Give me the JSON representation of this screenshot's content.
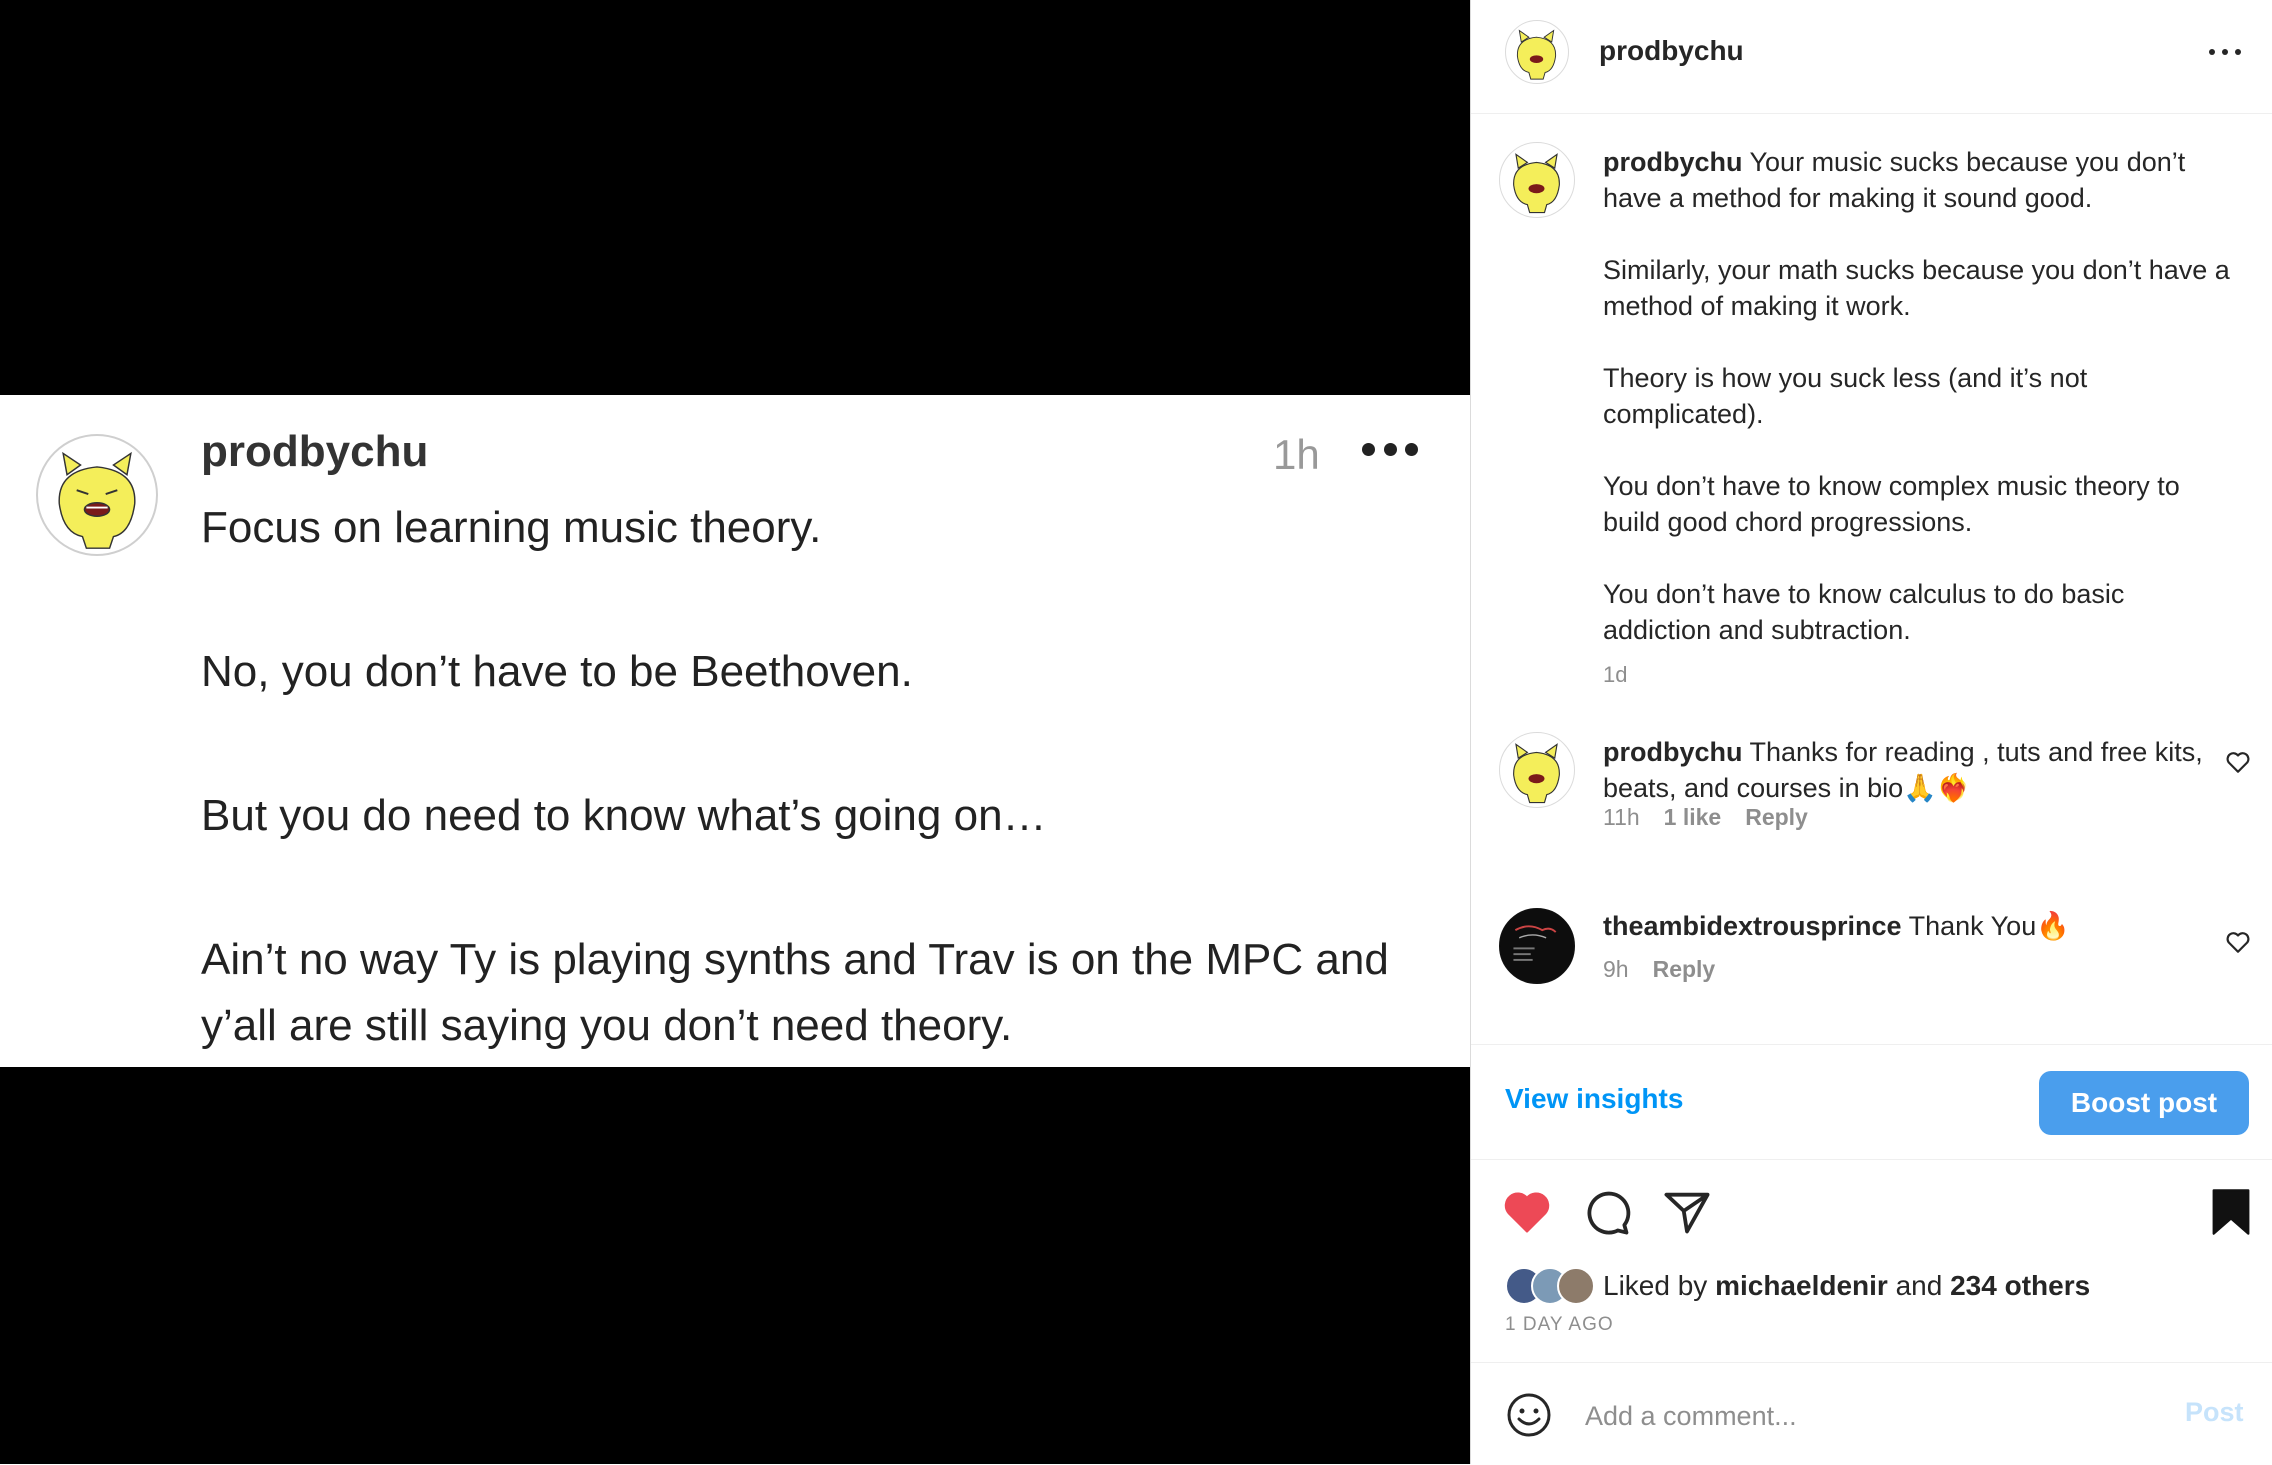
{
  "media": {
    "card": {
      "username": "prodbychu",
      "time": "1h",
      "paragraphs": [
        "Focus on learning music theory.",
        "No, you don’t have to be Beethoven.",
        "But you do need to know what’s going on…",
        "Ain’t no way Ty is playing synths and Trav is on the MPC and y’all are still saying you don’t need theory."
      ]
    }
  },
  "header": {
    "username": "prodbychu"
  },
  "caption": {
    "username": "prodbychu",
    "paragraphs": [
      "Your music sucks because you don’t have a method for making it sound good.",
      "Similarly, your math sucks because you don’t have a method of making it work.",
      "Theory is how you suck less (and it’s not complicated).",
      "You don’t have to know complex music theory to build good chord progressions.",
      "You don’t have to know calculus to do basic addiction and subtraction."
    ],
    "time": "1d"
  },
  "comments": [
    {
      "username": "prodbychu",
      "text": "Thanks for reading , tuts and free kits, beats, and courses in bio🙏❤️‍🔥",
      "time": "11h",
      "likes": "1 like",
      "reply": "Reply"
    },
    {
      "username": "theambidextrousprince",
      "text": "Thank You🔥",
      "time": "9h",
      "reply": "Reply"
    }
  ],
  "insights": {
    "view_label": "View insights",
    "boost_label": "Boost post"
  },
  "likes": {
    "prefix": "Liked by",
    "user": "michaeldenir",
    "middle": "and",
    "others": "234 others",
    "ago": "1 DAY AGO"
  },
  "add_comment": {
    "placeholder": "Add a comment...",
    "post_label": "Post"
  },
  "colors": {
    "accent": "#0095f6",
    "boost_bg": "#4a9eed",
    "heart": "#ed4956",
    "avatar_yellow": "#f4ee5a"
  }
}
